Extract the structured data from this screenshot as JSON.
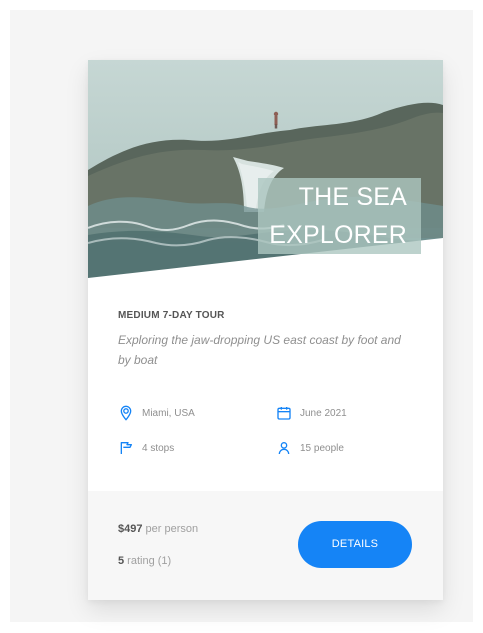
{
  "card": {
    "title_lines": [
      "THE SEA",
      "EXPLORER"
    ],
    "subtitle": "MEDIUM 7-DAY TOUR",
    "description": "Exploring the jaw-dropping US east coast by foot and by boat",
    "meta": {
      "location": "Miami, USA",
      "date": "June 2021",
      "stops": "4 stops",
      "people": "15 people"
    },
    "footer": {
      "price_amount": "$497",
      "price_suffix": " per person",
      "rating_value": "5",
      "rating_suffix": " rating (1)",
      "details_label": "DETAILS"
    }
  },
  "colors": {
    "accent": "#1584f6",
    "text_muted": "#8f8f8f",
    "title_overlay": "#acc7c0"
  },
  "icons": {
    "location": "map-pin-icon",
    "date": "calendar-icon",
    "stops": "flag-icon",
    "people": "user-icon"
  }
}
